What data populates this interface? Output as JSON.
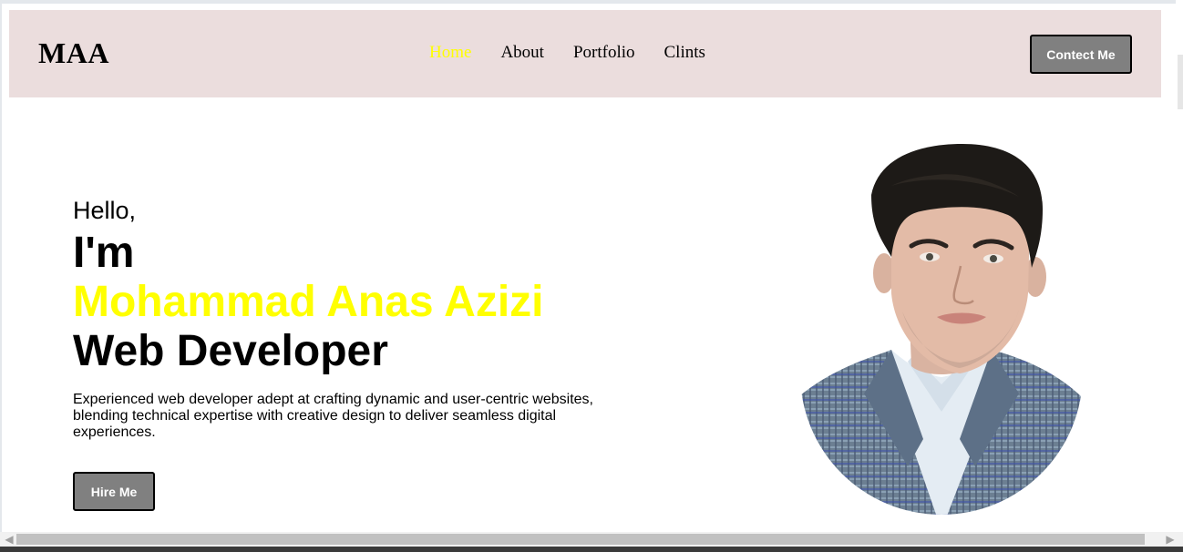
{
  "header": {
    "logo": "MAA",
    "nav": [
      {
        "label": "Home",
        "active": true
      },
      {
        "label": "About",
        "active": false
      },
      {
        "label": "Portfolio",
        "active": false
      },
      {
        "label": "Clints",
        "active": false
      }
    ],
    "contact_label": "Contect Me"
  },
  "hero": {
    "greeting": "Hello,",
    "intro": "I'm",
    "name": "Mohammad Anas Azizi",
    "role": "Web Developer",
    "description": "Experienced web developer adept at crafting dynamic and user-centric websites, blending technical expertise with creative design to deliver seamless digital experiences.",
    "hire_label": "Hire Me"
  },
  "colors": {
    "header_bg": "#ebdddd",
    "accent": "#ffff00",
    "button_bg": "#808080"
  },
  "icons": {
    "scroll_left": "chevron-left-icon",
    "scroll_right": "chevron-right-icon"
  }
}
